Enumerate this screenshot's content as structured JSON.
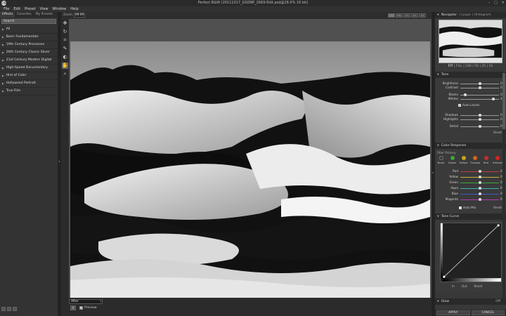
{
  "window": {
    "title": "Perfect B&W (20111017_GSDNP_2669-Edit.psd@28.0% 16 bit)",
    "logo": "ON",
    "controls": [
      "–",
      "□",
      "✕"
    ]
  },
  "menu": [
    "File",
    "Edit",
    "Preset",
    "View",
    "Window",
    "Help"
  ],
  "left_panel": {
    "tabs": [
      "Effects",
      "Favorites",
      "My Presets"
    ],
    "search_placeholder": "Search",
    "presets": [
      "All",
      "Basic Fundamentals",
      "19th Century Processes",
      "20th Century Classic Silver",
      "21st Century Modern Digital",
      "High-Speed Documentary",
      "Hint of Color",
      "Hollywood Portrait",
      "True Film"
    ]
  },
  "toolbar": {
    "zoom_label": "Zoom",
    "zoom_value": "28.00",
    "view_buttons": [
      "",
      "FILL",
      "1:1",
      "2:1",
      "3:1"
    ]
  },
  "tools": [
    "hand-tool",
    "rotate-tool",
    "crop-tool",
    "brush-tool",
    "gradient-tool",
    "pan-tool",
    "zoom-tool"
  ],
  "bottom_bar": {
    "filter_value": "After",
    "before_label": "A",
    "preview_label": "Preview",
    "preview_checked": true
  },
  "navigator": {
    "title": "Navigator",
    "tabs": "| Loupe | Histogram",
    "zoom_options": [
      "FIT",
      "FILL",
      "100",
      "50",
      "25",
      "10"
    ]
  },
  "tone": {
    "title": "Tone",
    "sliders": [
      {
        "label": "Brightness",
        "value": "0",
        "level": 0.5
      },
      {
        "label": "Contrast",
        "value": "0",
        "level": 0.5
      },
      {
        "label": "Blacks",
        "value": "0",
        "level": 0.12
      },
      {
        "label": "Whites",
        "value": "46",
        "level": 0.85
      },
      {
        "label": "Shadows",
        "value": "0",
        "level": 0.5
      },
      {
        "label": "Highlights",
        "value": "0",
        "level": 0.5
      },
      {
        "label": "Detail",
        "value": "0",
        "level": 0.5
      }
    ],
    "auto_levels": "Auto Levels",
    "reset": "Reset"
  },
  "color_response": {
    "title": "Color Response",
    "filter_primary_label": "Filter Primary",
    "filters": [
      {
        "name": "None",
        "color": "#3a3a3a"
      },
      {
        "name": "Green",
        "color": "#3fa13f"
      },
      {
        "name": "Yellow",
        "color": "#c8a21e"
      },
      {
        "name": "Orange",
        "color": "#c96a1c"
      },
      {
        "name": "Red",
        "color": "#c0302a"
      },
      {
        "name": "Infrared",
        "color": "#d8231e"
      }
    ],
    "sliders": [
      {
        "label": "Red",
        "value": "0",
        "color": "#c23a3a"
      },
      {
        "label": "Yellow",
        "value": "0",
        "color": "#c8b43a"
      },
      {
        "label": "Green",
        "value": "0",
        "color": "#3aa83a"
      },
      {
        "label": "Aqua",
        "value": "0",
        "color": "#3ab5b5"
      },
      {
        "label": "Blue",
        "value": "0",
        "color": "#3a5ec8"
      },
      {
        "label": "Magenta",
        "value": "0",
        "color": "#b23ab2"
      }
    ],
    "auto_mix": "Auto Mix",
    "reset": "Reset"
  },
  "tone_curve": {
    "title": "Tone Curve",
    "in_label": "In",
    "out_label": "Out",
    "reset": "Reset"
  },
  "glow": {
    "title": "Glow",
    "state": "Off"
  },
  "actions": {
    "apply": "APPLY",
    "cancel": "CANCEL"
  }
}
